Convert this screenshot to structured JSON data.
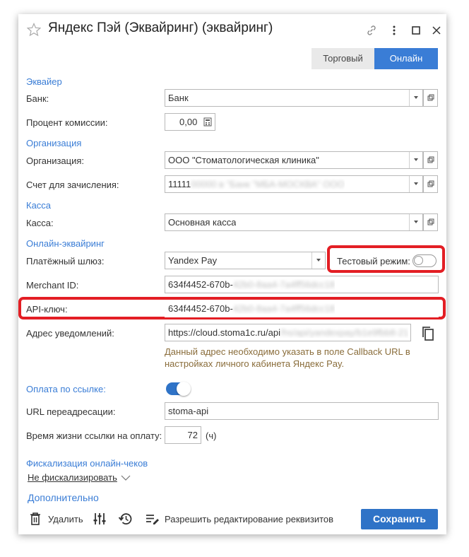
{
  "window": {
    "title": "Яндекс Пэй (Эквайринг) (эквайринг)",
    "tabs": [
      {
        "label": "Торговый",
        "active": false
      },
      {
        "label": "Онлайн",
        "active": true
      }
    ]
  },
  "sections": {
    "acquirer": "Эквайер",
    "organization": "Организация",
    "cashbox": "Касса",
    "online_acquiring": "Онлайн-эквайринг",
    "fiscalization": "Фискализация онлайн-чеков",
    "additional": "Дополнительно"
  },
  "fields": {
    "bank": {
      "label": "Банк:",
      "value": "Банк"
    },
    "commission": {
      "label": "Процент комиссии:",
      "value": "0,00"
    },
    "organization": {
      "label": "Организация:",
      "value": "ООО \"Стоматологическая клиника\""
    },
    "account": {
      "label": "Счет для зачисления:",
      "value": "11111",
      "value_blurred": "00000 в \"Банк \"МБА-МОСКВА\" ООО"
    },
    "cashbox": {
      "label": "Касса:",
      "value": "Основная касса"
    },
    "gateway": {
      "label": "Платёжный шлюз:",
      "value": "Yandex Pay"
    },
    "test_mode": {
      "label": "Тестовый режим:",
      "enabled": false
    },
    "merchant_id": {
      "label": "Merchant ID:",
      "value": "634f4452-670b-",
      "value_blurred": "42b0-8aa4-7a4ff56dcc18"
    },
    "api_key": {
      "label": "API-ключ:",
      "value": "634f4452-670b-",
      "value_blurred": "42b0-8aa4-7a4ff56dcc18"
    },
    "notify_url": {
      "label": "Адрес уведомлений:",
      "value": "https://cloud.stoma1c.ru/api",
      "value_blurred": "/hs/api/yandexpay/b1e9fbb8-21"
    },
    "notify_hint": "Данный адрес необходимо указать в поле Callback URL в настройках личного кабинета Яндекс Pay.",
    "pay_by_link": {
      "label": "Оплата по ссылке:",
      "enabled": true
    },
    "redirect_url": {
      "label": "URL переадресации:",
      "value": "stoma-api"
    },
    "link_lifetime": {
      "label": "Время жизни ссылки на оплату:",
      "value": "72",
      "unit": "(ч)"
    },
    "fiscal_mode": "Не фискализировать"
  },
  "footer": {
    "delete": "Удалить",
    "allow_edit": "Разрешить редактирование реквизитов",
    "save": "Сохранить"
  },
  "colors": {
    "accent": "#3a7dd6",
    "highlight": "#e31e24",
    "save_button": "#2f73c7"
  }
}
